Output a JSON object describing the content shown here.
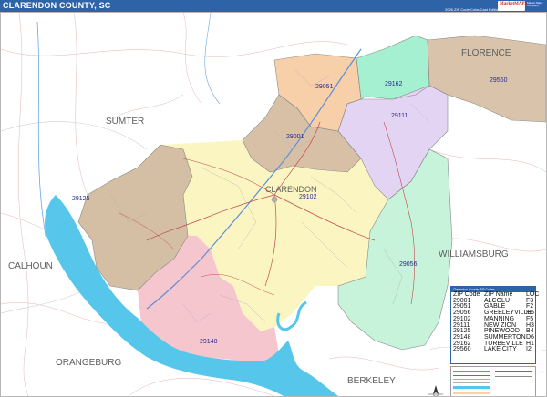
{
  "header": {
    "title": "CLARENDON COUNTY, SC",
    "edition": "2026 ZIP Code Color/Cast Edition",
    "logo_text": "MarketMAPS",
    "logo_side": "Market Maps Company"
  },
  "place_labels": {
    "florence": "FLORENCE",
    "sumter": "SUMTER",
    "clarendon": "CLARENDON",
    "calhoun": "CALHOUN",
    "williamsburg": "WILLIAMSBURG",
    "orangeburg": "ORANGEBURG",
    "berkeley": "BERKELEY"
  },
  "zip_labels": {
    "z29560": "29560",
    "z29162": "29162",
    "z29051": "29051",
    "z29111": "29111",
    "z29001": "29001",
    "z29102": "29102",
    "z29125": "29125",
    "z29056": "29056",
    "z29148": "29148"
  },
  "zip_colors": {
    "29051": "#f7cfa8",
    "29001": "#d7c0a6",
    "29125": "#d4bfa5",
    "29102": "#fbf6c1",
    "29148": "#f6c6cf",
    "29111": "#e4d4f3",
    "29162": "#a4f0d0",
    "29056": "#c6f3d9",
    "29560": "#d9c4ab",
    "water": "#56c7ea"
  },
  "legend": {
    "header": "Clarendon County ZIP Codes",
    "col_zip": "ZIP Code",
    "col_name": "ZIP Name",
    "col_loc": "LOC",
    "rows": [
      {
        "zip": "29001",
        "name": "ALCOLU",
        "loc": "F3"
      },
      {
        "zip": "29051",
        "name": "GABLE",
        "loc": "F2"
      },
      {
        "zip": "29056",
        "name": "GREELEYVILLE",
        "loc": "H5"
      },
      {
        "zip": "29102",
        "name": "MANNING",
        "loc": "F5"
      },
      {
        "zip": "29111",
        "name": "NEW ZION",
        "loc": "H3"
      },
      {
        "zip": "29125",
        "name": "PINEWOOD",
        "loc": "B4"
      },
      {
        "zip": "29148",
        "name": "SUMMERTON",
        "loc": "D6"
      },
      {
        "zip": "29162",
        "name": "TURBEVILLE",
        "loc": "H1"
      },
      {
        "zip": "29560",
        "name": "LAKE CITY",
        "loc": "I2"
      }
    ]
  }
}
